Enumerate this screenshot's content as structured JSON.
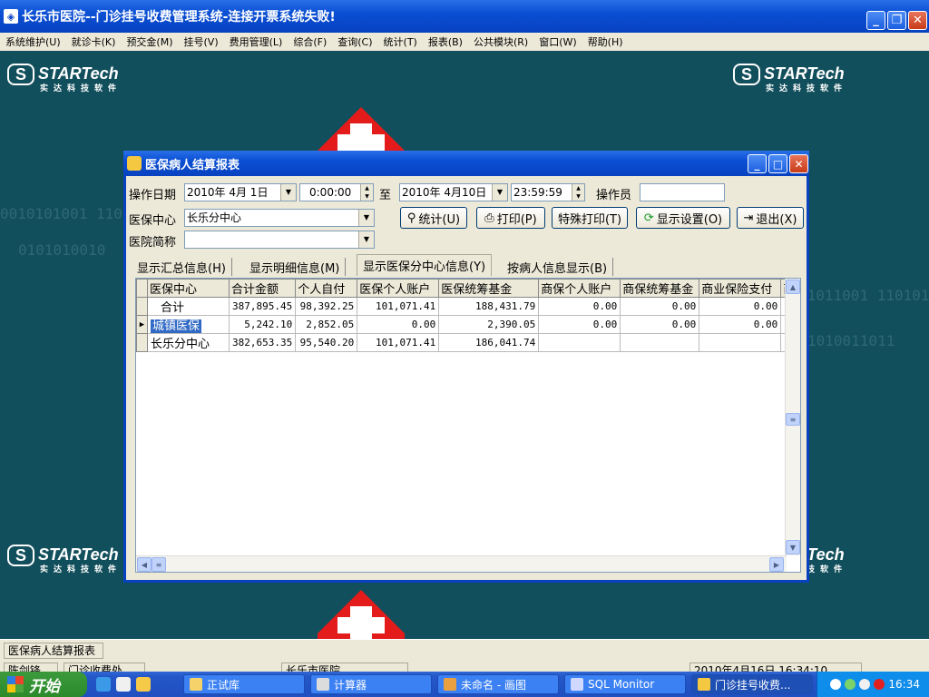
{
  "window": {
    "title": "长乐市医院--门诊挂号收费管理系统-连接开票系统失败!",
    "controls": {
      "minimize": "_",
      "maximize": "❐",
      "close": "✕"
    }
  },
  "menu": [
    "系统维护(U)",
    "就诊卡(K)",
    "预交金(M)",
    "挂号(V)",
    "费用管理(L)",
    "综合(F)",
    "查询(C)",
    "统计(T)",
    "报表(B)",
    "公共模块(R)",
    "窗口(W)",
    "帮助(H)"
  ],
  "brand": {
    "name": "STARTech",
    "tagline": "实达科技软件",
    "mark": "S"
  },
  "dialog": {
    "title": "医保病人结算报表",
    "controls": {
      "minimize": "_",
      "maximize": "□",
      "close": "✕"
    },
    "filters": {
      "op_date_label": "操作日期",
      "date_from": "2010年 4月 1日",
      "time_from": "0:00:00",
      "to_label": "至",
      "date_to": "2010年 4月10日",
      "time_to": "23:59:59",
      "operator_label": "操作员",
      "operator_value": "",
      "center_label": "医保中心",
      "center_value": "长乐分中心",
      "hospital_label": "医院简称",
      "hospital_value": ""
    },
    "buttons": {
      "stat": "统计(U)",
      "print": "打印(P)",
      "special_print": "特殊打印(T)",
      "display_settings": "显示设置(O)",
      "exit": "退出(X)"
    },
    "tabs": [
      "显示汇总信息(H)",
      "显示明细信息(M)",
      "显示医保分中心信息(Y)",
      "按病人信息显示(B)"
    ],
    "active_tab": 2,
    "grid": {
      "columns": [
        "医保中心",
        "合计金额",
        "个人自付",
        "医保个人账户",
        "医保统筹基金",
        "商保个人账户",
        "商保统筹基金",
        "商业保险支付",
        "商"
      ],
      "rows": [
        {
          "indicator": "",
          "cells": [
            "合计",
            "387,895.45",
            "98,392.25",
            "101,071.41",
            "188,431.79",
            "0.00",
            "0.00",
            "0.00",
            ""
          ]
        },
        {
          "indicator": "▶",
          "cells": [
            "城镇医保",
            "5,242.10",
            "2,852.05",
            "0.00",
            "2,390.05",
            "0.00",
            "0.00",
            "0.00",
            ""
          ]
        },
        {
          "indicator": "",
          "cells": [
            "长乐分中心",
            "382,653.35",
            "95,540.20",
            "101,071.41",
            "186,041.74",
            "",
            "",
            "",
            ""
          ]
        }
      ],
      "selected_row": 1
    }
  },
  "statusbar": {
    "panel1": "医保病人结算报表",
    "panel2": "陈剑锋",
    "panel3": "门诊收费处",
    "panel4": "长乐市医院",
    "panel5": "2010年4月16日 16:34:10"
  },
  "taskbar": {
    "start": "开始",
    "tasks": [
      "正试库",
      "计算器",
      "未命名 - 画图",
      "SQL Monitor",
      "门诊挂号收费..."
    ],
    "active_task": 4,
    "clock": "16:34"
  }
}
